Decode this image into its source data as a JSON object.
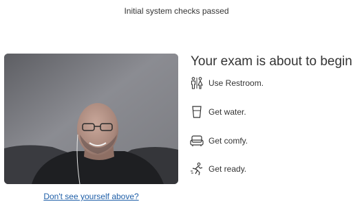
{
  "status": {
    "text": "Initial system checks passed"
  },
  "webcam": {
    "link_text": "Don't see yourself above?"
  },
  "checklist": {
    "heading": "Your exam is about to begin.",
    "items": [
      {
        "label": "Use Restroom.",
        "icon": "restroom-icon"
      },
      {
        "label": "Get water.",
        "icon": "water-glass-icon"
      },
      {
        "label": "Get comfy.",
        "icon": "armchair-icon"
      },
      {
        "label": "Get ready.",
        "icon": "runner-icon"
      }
    ]
  },
  "colors": {
    "link": "#1f5fa8",
    "text": "#333333",
    "background": "#ffffff"
  }
}
